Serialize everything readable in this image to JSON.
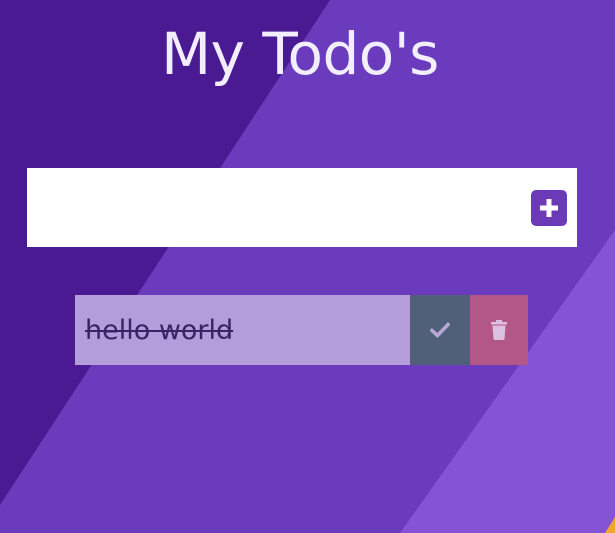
{
  "header": {
    "title": "My Todo's"
  },
  "form": {
    "input_value": "",
    "input_placeholder": "",
    "add_icon": "plus-square-icon"
  },
  "todos": [
    {
      "text": "hello world",
      "completed": true,
      "complete_icon": "check-icon",
      "delete_icon": "trash-icon"
    }
  ],
  "colors": {
    "background_dark": "#4a1a93",
    "background_mid": "#6a3bbd",
    "background_light": "#8453d6",
    "accent": "#6b3ab8",
    "title_text": "#f3eefe",
    "todo_item_bg": "#b39ddb",
    "complete_button_bg": "#4f6078",
    "delete_button_bg": "#b35688"
  }
}
